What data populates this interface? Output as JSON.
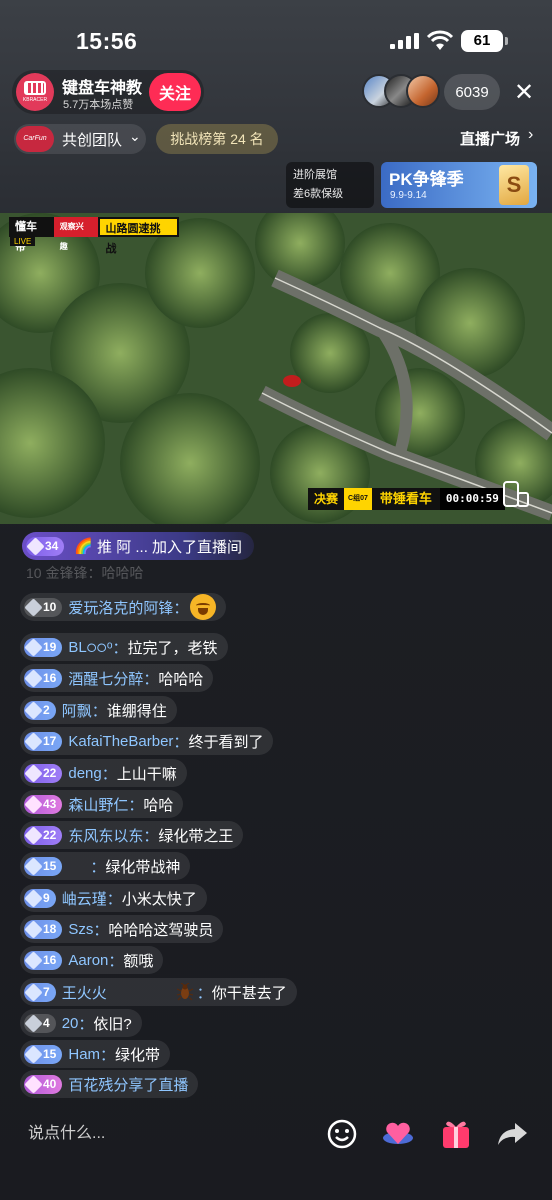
{
  "status": {
    "time": "15:56",
    "battery": "61"
  },
  "host": {
    "name": "键盘车神教",
    "likes": "5.7万本场点赞",
    "avatar_text": "KBRACER",
    "follow": "关注"
  },
  "viewers": {
    "count": "6039"
  },
  "team": {
    "logo_text": "CarFun",
    "label": "共创团队"
  },
  "rank": "挑战榜第 24 名",
  "plaza": "直播广场",
  "promo": {
    "line1": "进阶展馆",
    "line2": "差6款保级",
    "pk_title": "PK争锋季",
    "pk_date": "9.9-9.14",
    "pk_icon": "S"
  },
  "video": {
    "brand": "懂车帝",
    "brand_sub": "观察兴趣",
    "event": "山路圆速挑战",
    "live": "LIVE",
    "final": "决赛",
    "car_no": "C组07",
    "player": "带锤看车",
    "timer": "00:00:59"
  },
  "chat": {
    "join": {
      "level": "34",
      "rainbow": "🌈",
      "text": "推 阿 ... 加入了直播间"
    },
    "faded": "10  金锋锋：哈哈哈",
    "lines": [
      {
        "level": "10",
        "user": "爱玩洛克的阿锋",
        "sep": "：",
        "msg": ""
      },
      {
        "level": "19",
        "user": "BL੦੦ᵒ",
        "sep": "：",
        "msg": "拉完了，老铁"
      },
      {
        "level": "16",
        "user": "酒醒七分醉",
        "sep": "：",
        "msg": "哈哈哈"
      },
      {
        "level": "2",
        "user": "阿飘",
        "sep": "：",
        "msg": "谁绷得住"
      },
      {
        "level": "17",
        "user": "KafaiTheBarber",
        "sep": "：",
        "msg": "终于看到了"
      },
      {
        "level": "22",
        "user": "deng",
        "sep": "：",
        "msg": "上山干嘛"
      },
      {
        "level": "43",
        "user": "森山野仁",
        "sep": "：",
        "msg": "哈哈"
      },
      {
        "level": "22",
        "user": "东风东以东",
        "sep": "：",
        "msg": "绿化带之王"
      },
      {
        "level": "15",
        "user": "",
        "sep": "：",
        "msg": "绿化带战神"
      },
      {
        "level": "9",
        "user": "岫云瑾",
        "sep": "：",
        "msg": "小米太快了"
      },
      {
        "level": "18",
        "user": "Szs",
        "sep": "：",
        "msg": "哈哈哈这驾驶员"
      },
      {
        "level": "16",
        "user": "Aaron",
        "sep": "：",
        "msg": "额哦"
      },
      {
        "level": "7",
        "user": "王火火",
        "sep": "：",
        "msg": "你干甚去了"
      },
      {
        "level": "4",
        "user": "20",
        "sep": "：",
        "msg": "依旧?"
      },
      {
        "level": "15",
        "user": "Ham",
        "sep": "：",
        "msg": "绿化带"
      },
      {
        "level": "40",
        "user": "百花残",
        "sep": " ",
        "msg": "分享了直播"
      }
    ]
  },
  "input": {
    "placeholder": "说点什么..."
  },
  "colors": {
    "follow": "#fe2c55",
    "username": "#8fc6ff",
    "accent_yellow": "#ffd400"
  }
}
